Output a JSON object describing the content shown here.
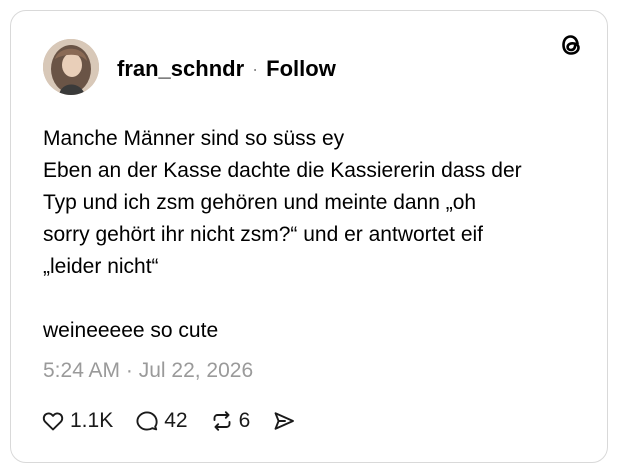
{
  "post": {
    "username": "fran_schndr",
    "separator": "·",
    "follow_label": "Follow",
    "lines": [
      "Manche Männer sind so süss ey",
      "Eben an der Kasse dachte die Kassiererin dass der",
      "Typ und ich zsm gehören und meinte dann „oh",
      "sorry gehört ihr nicht zsm?“ und er antwortet eif",
      "„leider nicht“"
    ],
    "last_line": "weineeeee so cute",
    "timestamp": "5:24 AM · Jul 22, 2026"
  },
  "actions": {
    "likes": "1.1K",
    "replies": "42",
    "reposts": "6"
  },
  "icons": {
    "brand": "threads-logo-icon",
    "like": "heart-icon",
    "reply": "speech-bubble-icon",
    "repost": "repost-arrows-icon",
    "share": "send-icon"
  },
  "colors": {
    "border": "#d9d9d9",
    "muted_text": "#9a9a9a",
    "text": "#000000"
  }
}
